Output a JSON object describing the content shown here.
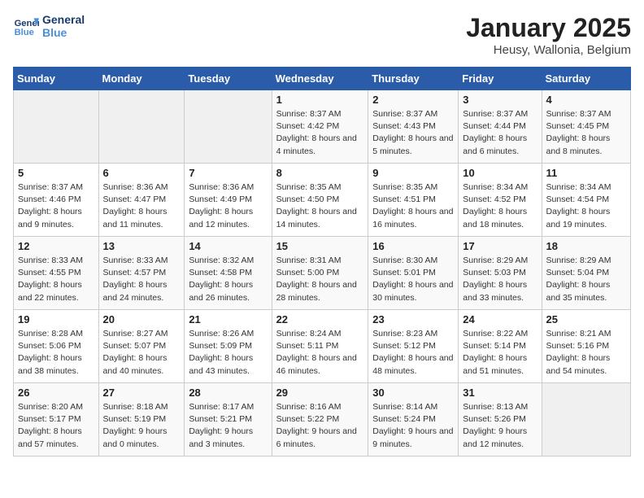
{
  "header": {
    "logo_line1": "General",
    "logo_line2": "Blue",
    "month": "January 2025",
    "location": "Heusy, Wallonia, Belgium"
  },
  "weekdays": [
    "Sunday",
    "Monday",
    "Tuesday",
    "Wednesday",
    "Thursday",
    "Friday",
    "Saturday"
  ],
  "weeks": [
    [
      {
        "day": "",
        "empty": true
      },
      {
        "day": "",
        "empty": true
      },
      {
        "day": "",
        "empty": true
      },
      {
        "day": "1",
        "sunrise": "8:37 AM",
        "sunset": "4:42 PM",
        "daylight": "8 hours and 4 minutes."
      },
      {
        "day": "2",
        "sunrise": "8:37 AM",
        "sunset": "4:43 PM",
        "daylight": "8 hours and 5 minutes."
      },
      {
        "day": "3",
        "sunrise": "8:37 AM",
        "sunset": "4:44 PM",
        "daylight": "8 hours and 6 minutes."
      },
      {
        "day": "4",
        "sunrise": "8:37 AM",
        "sunset": "4:45 PM",
        "daylight": "8 hours and 8 minutes."
      }
    ],
    [
      {
        "day": "5",
        "sunrise": "8:37 AM",
        "sunset": "4:46 PM",
        "daylight": "8 hours and 9 minutes."
      },
      {
        "day": "6",
        "sunrise": "8:36 AM",
        "sunset": "4:47 PM",
        "daylight": "8 hours and 11 minutes."
      },
      {
        "day": "7",
        "sunrise": "8:36 AM",
        "sunset": "4:49 PM",
        "daylight": "8 hours and 12 minutes."
      },
      {
        "day": "8",
        "sunrise": "8:35 AM",
        "sunset": "4:50 PM",
        "daylight": "8 hours and 14 minutes."
      },
      {
        "day": "9",
        "sunrise": "8:35 AM",
        "sunset": "4:51 PM",
        "daylight": "8 hours and 16 minutes."
      },
      {
        "day": "10",
        "sunrise": "8:34 AM",
        "sunset": "4:52 PM",
        "daylight": "8 hours and 18 minutes."
      },
      {
        "day": "11",
        "sunrise": "8:34 AM",
        "sunset": "4:54 PM",
        "daylight": "8 hours and 19 minutes."
      }
    ],
    [
      {
        "day": "12",
        "sunrise": "8:33 AM",
        "sunset": "4:55 PM",
        "daylight": "8 hours and 22 minutes."
      },
      {
        "day": "13",
        "sunrise": "8:33 AM",
        "sunset": "4:57 PM",
        "daylight": "8 hours and 24 minutes."
      },
      {
        "day": "14",
        "sunrise": "8:32 AM",
        "sunset": "4:58 PM",
        "daylight": "8 hours and 26 minutes."
      },
      {
        "day": "15",
        "sunrise": "8:31 AM",
        "sunset": "5:00 PM",
        "daylight": "8 hours and 28 minutes."
      },
      {
        "day": "16",
        "sunrise": "8:30 AM",
        "sunset": "5:01 PM",
        "daylight": "8 hours and 30 minutes."
      },
      {
        "day": "17",
        "sunrise": "8:29 AM",
        "sunset": "5:03 PM",
        "daylight": "8 hours and 33 minutes."
      },
      {
        "day": "18",
        "sunrise": "8:29 AM",
        "sunset": "5:04 PM",
        "daylight": "8 hours and 35 minutes."
      }
    ],
    [
      {
        "day": "19",
        "sunrise": "8:28 AM",
        "sunset": "5:06 PM",
        "daylight": "8 hours and 38 minutes."
      },
      {
        "day": "20",
        "sunrise": "8:27 AM",
        "sunset": "5:07 PM",
        "daylight": "8 hours and 40 minutes."
      },
      {
        "day": "21",
        "sunrise": "8:26 AM",
        "sunset": "5:09 PM",
        "daylight": "8 hours and 43 minutes."
      },
      {
        "day": "22",
        "sunrise": "8:24 AM",
        "sunset": "5:11 PM",
        "daylight": "8 hours and 46 minutes."
      },
      {
        "day": "23",
        "sunrise": "8:23 AM",
        "sunset": "5:12 PM",
        "daylight": "8 hours and 48 minutes."
      },
      {
        "day": "24",
        "sunrise": "8:22 AM",
        "sunset": "5:14 PM",
        "daylight": "8 hours and 51 minutes."
      },
      {
        "day": "25",
        "sunrise": "8:21 AM",
        "sunset": "5:16 PM",
        "daylight": "8 hours and 54 minutes."
      }
    ],
    [
      {
        "day": "26",
        "sunrise": "8:20 AM",
        "sunset": "5:17 PM",
        "daylight": "8 hours and 57 minutes."
      },
      {
        "day": "27",
        "sunrise": "8:18 AM",
        "sunset": "5:19 PM",
        "daylight": "9 hours and 0 minutes."
      },
      {
        "day": "28",
        "sunrise": "8:17 AM",
        "sunset": "5:21 PM",
        "daylight": "9 hours and 3 minutes."
      },
      {
        "day": "29",
        "sunrise": "8:16 AM",
        "sunset": "5:22 PM",
        "daylight": "9 hours and 6 minutes."
      },
      {
        "day": "30",
        "sunrise": "8:14 AM",
        "sunset": "5:24 PM",
        "daylight": "9 hours and 9 minutes."
      },
      {
        "day": "31",
        "sunrise": "8:13 AM",
        "sunset": "5:26 PM",
        "daylight": "9 hours and 12 minutes."
      },
      {
        "day": "",
        "empty": true
      }
    ]
  ],
  "labels": {
    "sunrise": "Sunrise:",
    "sunset": "Sunset:",
    "daylight": "Daylight:"
  }
}
